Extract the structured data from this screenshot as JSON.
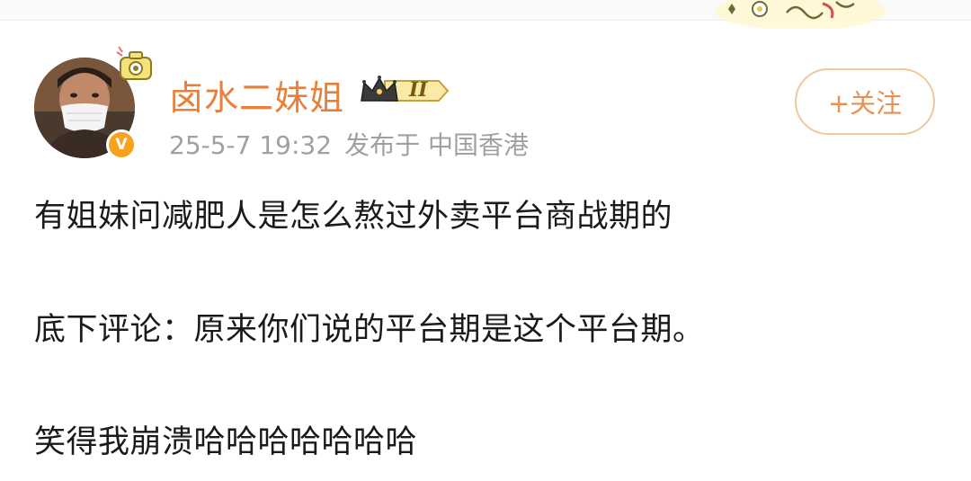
{
  "author": {
    "name": "卤水二妹姐",
    "vip_level": "II",
    "verified_icon": "V"
  },
  "meta": {
    "date": "25-5-7 19:32",
    "location": "发布于 中国香港"
  },
  "follow_button_label": "+关注",
  "post": {
    "lines": [
      "有姐妹问减肥人是怎么熬过外卖平台商战期的",
      "底下评论：原来你们说的平台期是这个平台期。",
      "笑得我崩溃哈哈哈哈哈哈哈"
    ]
  },
  "icons": [
    "avatar-photo",
    "camera-decoration-icon",
    "verified-badge-icon",
    "crown-vip-icon",
    "flower-decoration-icon"
  ],
  "colors": {
    "username": "#e8803c",
    "meta": "#a0a0a0",
    "follow_border": "#f0c79e",
    "follow_text": "#e88f55",
    "verified": "#f7a21b",
    "body_text": "#1a1a1a"
  }
}
